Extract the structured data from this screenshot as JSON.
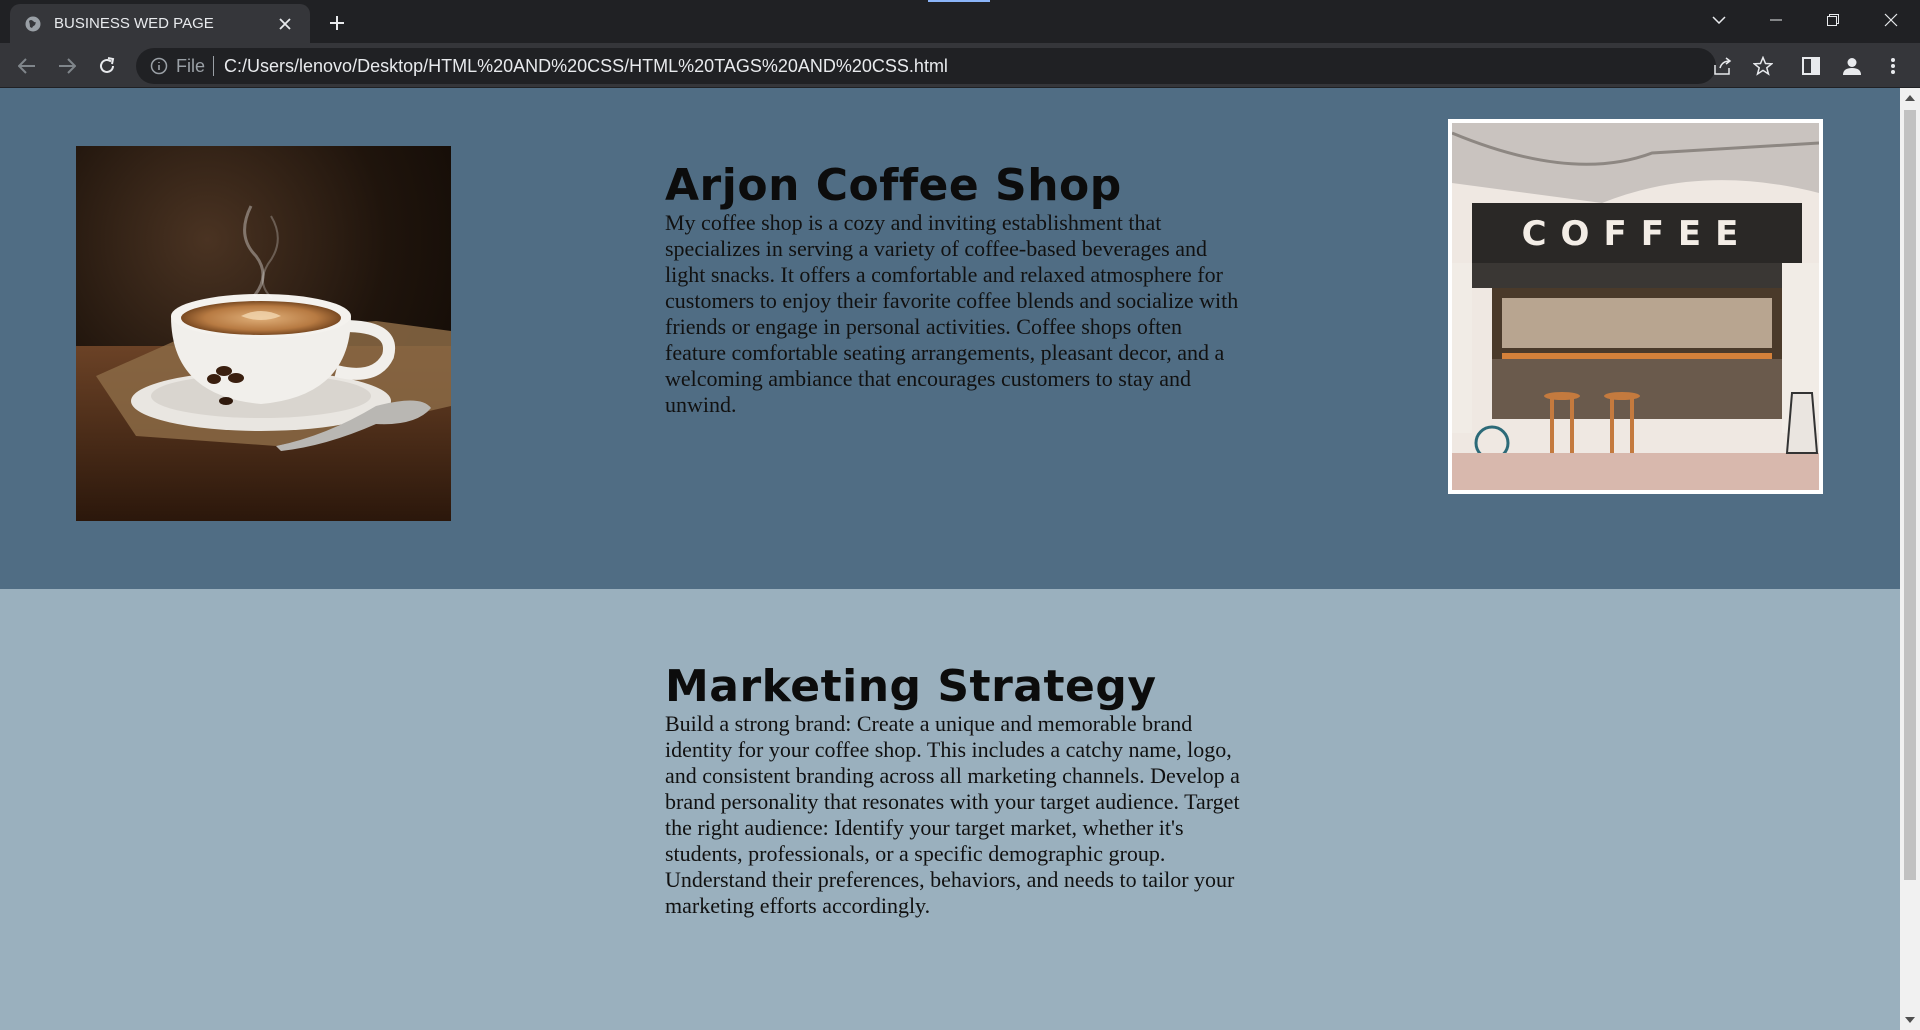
{
  "browser": {
    "tab_title": "BUSINESS WED PAGE",
    "url_scheme_label": "File",
    "url": "C:/Users/lenovo/Desktop/HTML%20AND%20CSS/HTML%20TAGS%20AND%20CSS.html"
  },
  "page": {
    "section1": {
      "title": "Arjon Coffee Shop",
      "body": "My coffee shop is a cozy and inviting establishment that specializes in serving a variety of coffee-based beverages and light snacks. It offers a comfortable and relaxed atmosphere for customers to enjoy their favorite coffee blends and socialize with friends or engage in personal activities. Coffee shops often feature comfortable seating arrangements, pleasant decor, and a welcoming ambiance that encourages customers to stay and unwind.",
      "background": "#506d84",
      "shop_sign_text": "COFFEE"
    },
    "section2": {
      "title": "Marketing Strategy",
      "body": "Build a strong brand: Create a unique and memorable brand identity for your coffee shop. This includes a catchy name, logo, and consistent branding across all marketing channels. Develop a brand personality that resonates with your target audience. Target the right audience: Identify your target market, whether it's students, professionals, or a specific demographic group. Understand their preferences, behaviors, and needs to tailor your marketing efforts accordingly.",
      "background": "#9ab0be"
    }
  },
  "icons": {
    "tab": "globe-icon",
    "nav": [
      "back-arrow-icon",
      "forward-arrow-icon",
      "reload-icon"
    ],
    "omnibox": [
      "info-icon",
      "share-icon",
      "star-icon"
    ],
    "toolbar_right": [
      "side-panel-icon",
      "profile-icon",
      "kebab-menu-icon"
    ]
  }
}
